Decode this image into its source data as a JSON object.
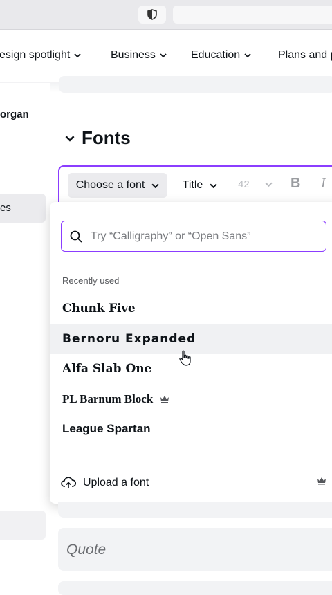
{
  "browser": {
    "shield_icon": "shield-icon"
  },
  "nav": {
    "items": [
      {
        "label": "esign spotlight"
      },
      {
        "label": "Business"
      },
      {
        "label": "Education"
      },
      {
        "label": "Plans and p"
      }
    ]
  },
  "sidebar": {
    "user_label": "organ",
    "selected_item": "es"
  },
  "section": {
    "heading": "Fonts"
  },
  "toolbar": {
    "font_button": "Choose a font",
    "style_button": "Title",
    "size_value": "42",
    "bold": "B",
    "italic": "I"
  },
  "dropdown": {
    "search_placeholder": "Try “Calligraphy” or “Open Sans”",
    "section_label": "Recently used",
    "fonts": [
      {
        "name": "Chunk Five",
        "premium": false
      },
      {
        "name": "Bernoru Expanded",
        "premium": false,
        "hovered": true
      },
      {
        "name": "Alfa Slab One",
        "premium": false
      },
      {
        "name": "PL Barnum Block",
        "premium": true
      },
      {
        "name": "League Spartan",
        "premium": false
      }
    ],
    "upload_label": "Upload a font"
  },
  "cards": {
    "quote_placeholder": "Quote"
  },
  "colors": {
    "accent": "#8b3dff",
    "text": "#0e1318"
  }
}
